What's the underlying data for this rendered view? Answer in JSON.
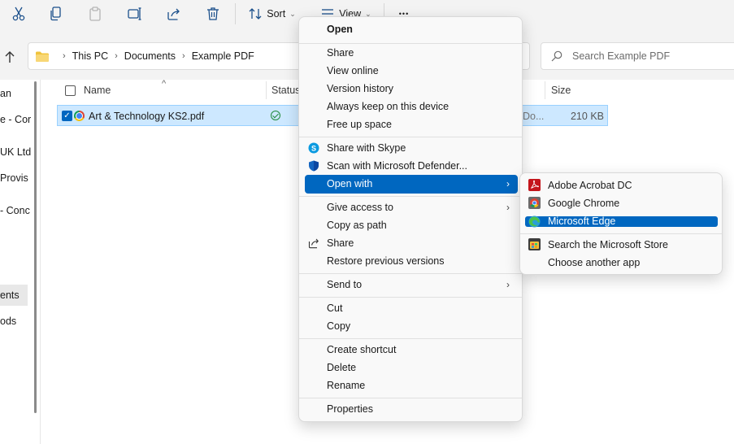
{
  "toolbar": {
    "sort_label": "Sort",
    "view_label": "View",
    "caret": "⌄",
    "more": "•••"
  },
  "address": {
    "crumbs": [
      "This PC",
      "Documents",
      "Example PDF"
    ],
    "separator": "›",
    "search_placeholder": "Search Example PDF"
  },
  "nav": {
    "items": [
      "an",
      "e - Cor",
      "UK Ltd",
      " Provis",
      " - Conc",
      "ents",
      "ods"
    ],
    "selected": "ents"
  },
  "columns": {
    "name": "Name",
    "status": "Status",
    "size": "Size",
    "sort_indicator": "^"
  },
  "file": {
    "name": "Art & Technology KS2.pdf",
    "type_fragment": "Do...",
    "size": "210 KB"
  },
  "context_menu": {
    "open": "Open",
    "share": "Share",
    "view_online": "View online",
    "version_history": "Version history",
    "always_keep": "Always keep on this device",
    "free_up_space": "Free up space",
    "share_skype": "Share with Skype",
    "scan_defender": "Scan with Microsoft Defender...",
    "open_with": "Open with",
    "give_access": "Give access to",
    "copy_as_path": "Copy as path",
    "share2": "Share",
    "restore_versions": "Restore previous versions",
    "send_to": "Send to",
    "cut": "Cut",
    "copy": "Copy",
    "create_shortcut": "Create shortcut",
    "delete": "Delete",
    "rename": "Rename",
    "properties": "Properties",
    "arrow": "›"
  },
  "submenu": {
    "acrobat": "Adobe Acrobat DC",
    "chrome": "Google Chrome",
    "edge": "Microsoft Edge",
    "store": "Search the Microsoft Store",
    "choose_app": "Choose another app"
  },
  "colors": {
    "accent": "#0067c0",
    "selection": "#cde8ff",
    "toolbar_bg": "#f3f3f3"
  }
}
